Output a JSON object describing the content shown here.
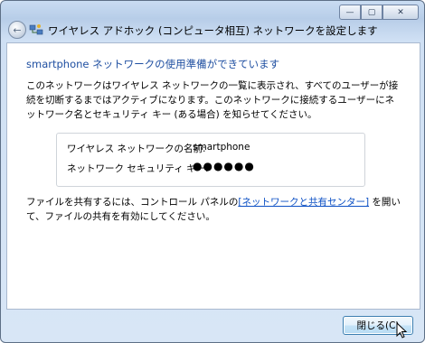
{
  "window": {
    "title": "ワイヤレス アドホック (コンピュータ相互) ネットワークを設定します",
    "buttons": {
      "minimize": "—",
      "maximize": "▢",
      "close": "✕"
    }
  },
  "nav": {
    "back_icon": "←"
  },
  "content": {
    "heading": "smartphone ネットワークの使用準備ができています",
    "paragraph_lines": [
      "このネットワークはワイヤレス ネットワークの一覧に表示され、すべてのユーザーが接",
      "続を切断するまではアクティブになります。このネットワークに接続するユーザーにネ",
      "ットワーク名とセキュリティ キー (ある場合) を知らせてください。"
    ],
    "info": {
      "name_label": "ワイヤレス ネットワークの名前:",
      "name_value": "smartphone",
      "key_label": "ネットワーク セキュリティ キー:",
      "key_value": "●●●●●●"
    },
    "sharing": {
      "text_before": "ファイルを共有するには、コントロール パネルの",
      "link_text": "[ネットワークと共有センター]",
      "text_after": " を開い",
      "line2": "て、ファイルの共有を有効にしてください。"
    }
  },
  "footer": {
    "close_label": "閉じる(C)"
  }
}
